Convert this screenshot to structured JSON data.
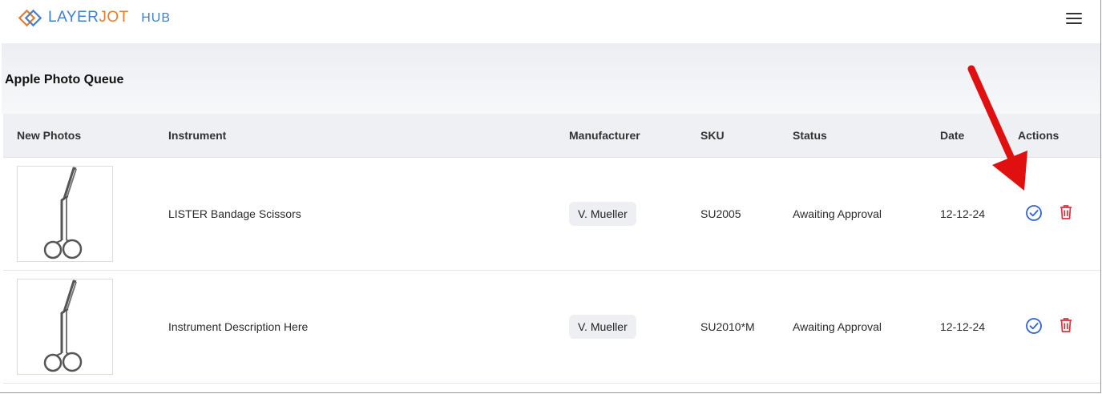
{
  "header": {
    "logo_part1": "LAYER",
    "logo_part2": "JOT",
    "logo_part3": "HUB",
    "menu_icon": "hamburger-menu-icon"
  },
  "page": {
    "title": "Apple Photo Queue"
  },
  "table": {
    "columns": [
      "New Photos",
      "Instrument",
      "Manufacturer",
      "SKU",
      "Status",
      "Date",
      "Actions"
    ],
    "rows": [
      {
        "instrument": "LISTER Bandage Scissors",
        "manufacturer": "V. Mueller",
        "sku": "SU2005",
        "status": "Awaiting Approval",
        "date": "12-12-24",
        "image": "scissors-photo",
        "approve_icon": "check-circle-icon",
        "delete_icon": "trash-icon"
      },
      {
        "instrument": "Instrument Description Here",
        "manufacturer": "V. Mueller",
        "sku": "SU2010*M",
        "status": "Awaiting Approval",
        "date": "12-12-24",
        "image": "scissors-photo",
        "approve_icon": "check-circle-icon",
        "delete_icon": "trash-icon"
      }
    ]
  },
  "colors": {
    "brand_blue": "#3f7fd6",
    "brand_orange": "#f07a22",
    "approve_blue": "#2f62d8",
    "delete_red": "#e0303a",
    "annotation_red": "#e01010"
  }
}
